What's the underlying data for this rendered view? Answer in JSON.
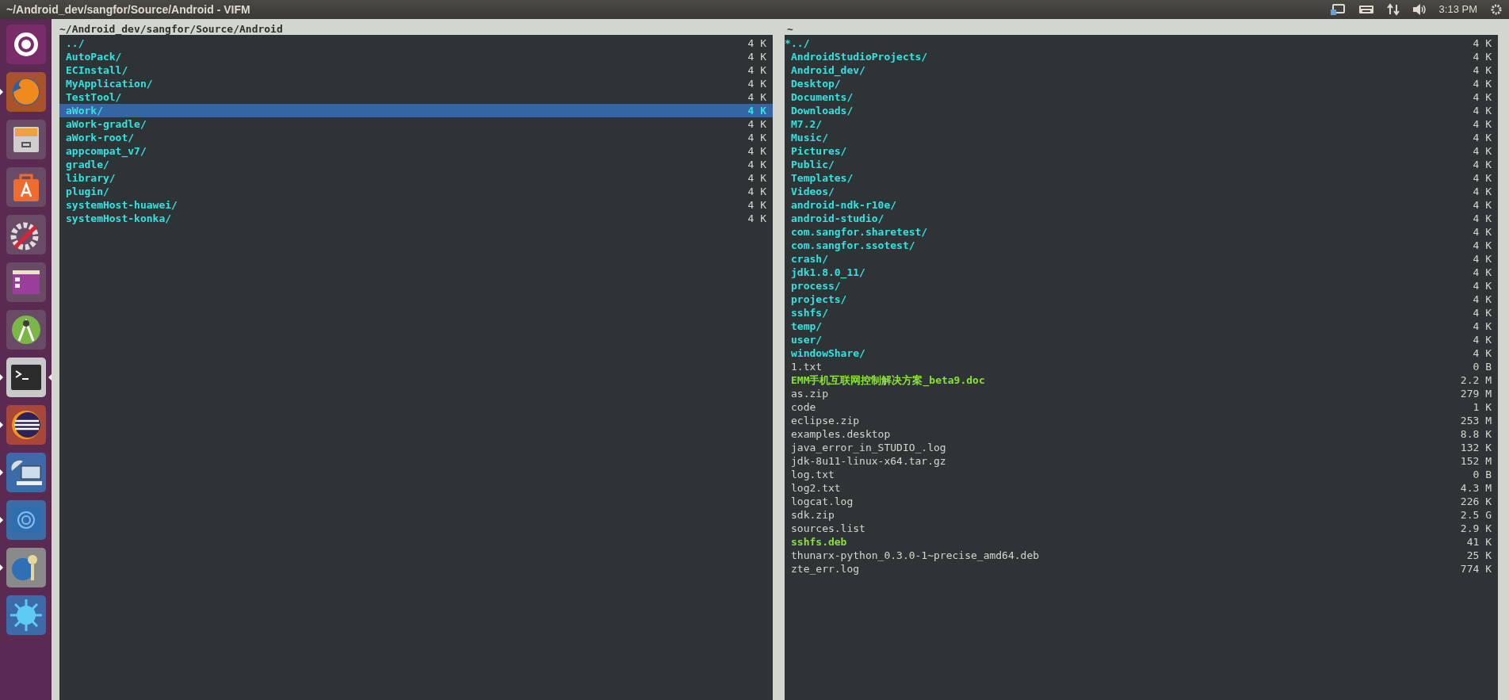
{
  "top_bar": {
    "title": "~/Android_dev/sangfor/Source/Android - VIFM",
    "time": "3:13 PM"
  },
  "launcher": [
    {
      "kind": "ubuntu",
      "running": false,
      "focused": false
    },
    {
      "kind": "firefox",
      "running": true,
      "focused": false
    },
    {
      "kind": "files",
      "running": false,
      "focused": false
    },
    {
      "kind": "store",
      "running": false,
      "focused": false
    },
    {
      "kind": "tools",
      "running": false,
      "focused": false
    },
    {
      "kind": "window",
      "running": false,
      "focused": false
    },
    {
      "kind": "android",
      "running": false,
      "focused": false
    },
    {
      "kind": "terminal",
      "running": true,
      "focused": true
    },
    {
      "kind": "eclipse",
      "running": true,
      "focused": false
    },
    {
      "kind": "network",
      "running": true,
      "focused": false
    },
    {
      "kind": "blue",
      "running": true,
      "focused": false
    },
    {
      "kind": "keys",
      "running": true,
      "focused": false
    },
    {
      "kind": "splash",
      "running": false,
      "focused": false
    }
  ],
  "panes": [
    {
      "path": "~/Android_dev/sangfor/Source/Android",
      "files": [
        {
          "name": "../",
          "size": "4 K",
          "kind": "dir",
          "selected": false
        },
        {
          "name": "AutoPack/",
          "size": "4 K",
          "kind": "dir",
          "selected": false
        },
        {
          "name": "ECInstall/",
          "size": "4 K",
          "kind": "dir",
          "selected": false
        },
        {
          "name": "MyApplication/",
          "size": "4 K",
          "kind": "dir",
          "selected": false
        },
        {
          "name": "TestTool/",
          "size": "4 K",
          "kind": "dir",
          "selected": false
        },
        {
          "name": "aWork/",
          "size": "4 K",
          "kind": "dir",
          "selected": true
        },
        {
          "name": "aWork-gradle/",
          "size": "4 K",
          "kind": "dir",
          "selected": false
        },
        {
          "name": "aWork-root/",
          "size": "4 K",
          "kind": "dir",
          "selected": false
        },
        {
          "name": "appcompat_v7/",
          "size": "4 K",
          "kind": "dir",
          "selected": false
        },
        {
          "name": "gradle/",
          "size": "4 K",
          "kind": "dir",
          "selected": false
        },
        {
          "name": "library/",
          "size": "4 K",
          "kind": "dir",
          "selected": false
        },
        {
          "name": "plugin/",
          "size": "4 K",
          "kind": "dir",
          "selected": false
        },
        {
          "name": "systemHost-huawei/",
          "size": "4 K",
          "kind": "dir",
          "selected": false
        },
        {
          "name": "systemHost-konka/",
          "size": "4 K",
          "kind": "dir",
          "selected": false
        }
      ]
    },
    {
      "path": "~",
      "files": [
        {
          "marker": "*",
          "name": "../",
          "size": "4 K",
          "kind": "dir",
          "selected": false
        },
        {
          "name": "AndroidStudioProjects/",
          "size": "4 K",
          "kind": "dir",
          "selected": false
        },
        {
          "name": "Android_dev/",
          "size": "4 K",
          "kind": "dir",
          "selected": false
        },
        {
          "name": "Desktop/",
          "size": "4 K",
          "kind": "dir",
          "selected": false
        },
        {
          "name": "Documents/",
          "size": "4 K",
          "kind": "dir",
          "selected": false
        },
        {
          "name": "Downloads/",
          "size": "4 K",
          "kind": "dir",
          "selected": false
        },
        {
          "name": "M7.2/",
          "size": "4 K",
          "kind": "dir",
          "selected": false
        },
        {
          "name": "Music/",
          "size": "4 K",
          "kind": "dir",
          "selected": false
        },
        {
          "name": "Pictures/",
          "size": "4 K",
          "kind": "dir",
          "selected": false
        },
        {
          "name": "Public/",
          "size": "4 K",
          "kind": "dir",
          "selected": false
        },
        {
          "name": "Templates/",
          "size": "4 K",
          "kind": "dir",
          "selected": false
        },
        {
          "name": "Videos/",
          "size": "4 K",
          "kind": "dir",
          "selected": false
        },
        {
          "name": "android-ndk-r10e/",
          "size": "4 K",
          "kind": "dir",
          "selected": false
        },
        {
          "name": "android-studio/",
          "size": "4 K",
          "kind": "dir",
          "selected": false
        },
        {
          "name": "com.sangfor.sharetest/",
          "size": "4 K",
          "kind": "dir",
          "selected": false
        },
        {
          "name": "com.sangfor.ssotest/",
          "size": "4 K",
          "kind": "dir",
          "selected": false
        },
        {
          "name": "crash/",
          "size": "4 K",
          "kind": "dir",
          "selected": false
        },
        {
          "name": "jdk1.8.0_11/",
          "size": "4 K",
          "kind": "dir",
          "selected": false
        },
        {
          "name": "process/",
          "size": "4 K",
          "kind": "dir",
          "selected": false
        },
        {
          "name": "projects/",
          "size": "4 K",
          "kind": "dir",
          "selected": false
        },
        {
          "name": "sshfs/",
          "size": "4 K",
          "kind": "dir",
          "selected": false
        },
        {
          "name": "temp/",
          "size": "4 K",
          "kind": "dir",
          "selected": false
        },
        {
          "name": "user/",
          "size": "4 K",
          "kind": "dir",
          "selected": false
        },
        {
          "name": "windowShare/",
          "size": "4 K",
          "kind": "dir",
          "selected": false
        },
        {
          "name": "1.txt",
          "size": "0 B",
          "kind": "file",
          "selected": false
        },
        {
          "name": "EMM手机互联网控制解决方案_beta9.doc",
          "size": "2.2 M",
          "kind": "exec",
          "selected": false
        },
        {
          "name": "as.zip",
          "size": "279 M",
          "kind": "file",
          "selected": false
        },
        {
          "name": "code",
          "size": "1 K",
          "kind": "file",
          "selected": false
        },
        {
          "name": "eclipse.zip",
          "size": "253 M",
          "kind": "file",
          "selected": false
        },
        {
          "name": "examples.desktop",
          "size": "8.8 K",
          "kind": "file",
          "selected": false
        },
        {
          "name": "java_error_in_STUDIO_.log",
          "size": "132 K",
          "kind": "file",
          "selected": false
        },
        {
          "name": "jdk-8u11-linux-x64.tar.gz",
          "size": "152 M",
          "kind": "file",
          "selected": false
        },
        {
          "name": "log.txt",
          "size": "0 B",
          "kind": "file",
          "selected": false
        },
        {
          "name": "log2.txt",
          "size": "4.3 M",
          "kind": "file",
          "selected": false
        },
        {
          "name": "logcat.log",
          "size": "226 K",
          "kind": "file",
          "selected": false
        },
        {
          "name": "sdk.zip",
          "size": "2.5 G",
          "kind": "file",
          "selected": false
        },
        {
          "name": "sources.list",
          "size": "2.9 K",
          "kind": "file",
          "selected": false
        },
        {
          "name": "sshfs.deb",
          "size": "41 K",
          "kind": "exec",
          "selected": false
        },
        {
          "name": "thunarx-python_0.3.0-1~precise_amd64.deb",
          "size": "25 K",
          "kind": "file",
          "selected": false
        },
        {
          "name": "zte_err.log",
          "size": "774 K",
          "kind": "file",
          "selected": false
        }
      ]
    }
  ]
}
